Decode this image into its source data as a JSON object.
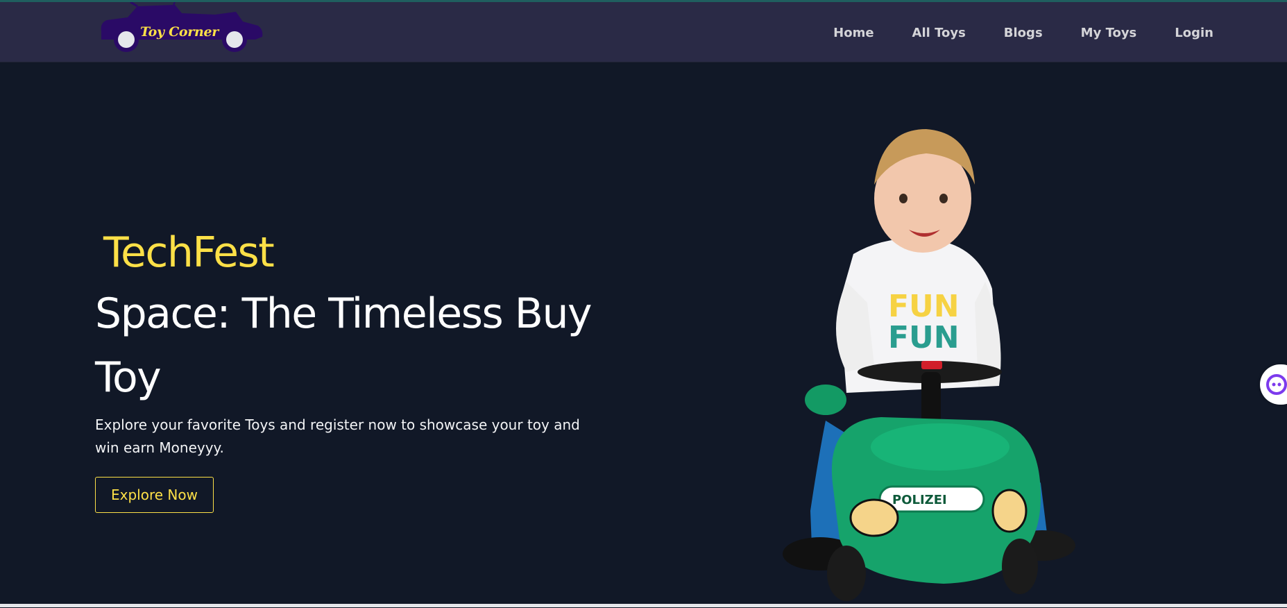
{
  "logo": {
    "text": "Toy Corner"
  },
  "nav": {
    "items": [
      "Home",
      "All Toys",
      "Blogs",
      "My Toys",
      "Login"
    ]
  },
  "hero": {
    "kicker": "TechFest",
    "title_line1": "Space: The Timeless Buy",
    "title_line2": "Toy",
    "description": "Explore your favorite Toys and register now to showcase your toy and win earn Moneyyy.",
    "button_label": "Explore Now",
    "car_badge_text": "POLIZEI"
  },
  "colors": {
    "accent": "#fde047",
    "background": "#111827",
    "navbar": "#2a2a46",
    "car_green": "#16a36b",
    "logo_purple": "#2a0a66"
  }
}
